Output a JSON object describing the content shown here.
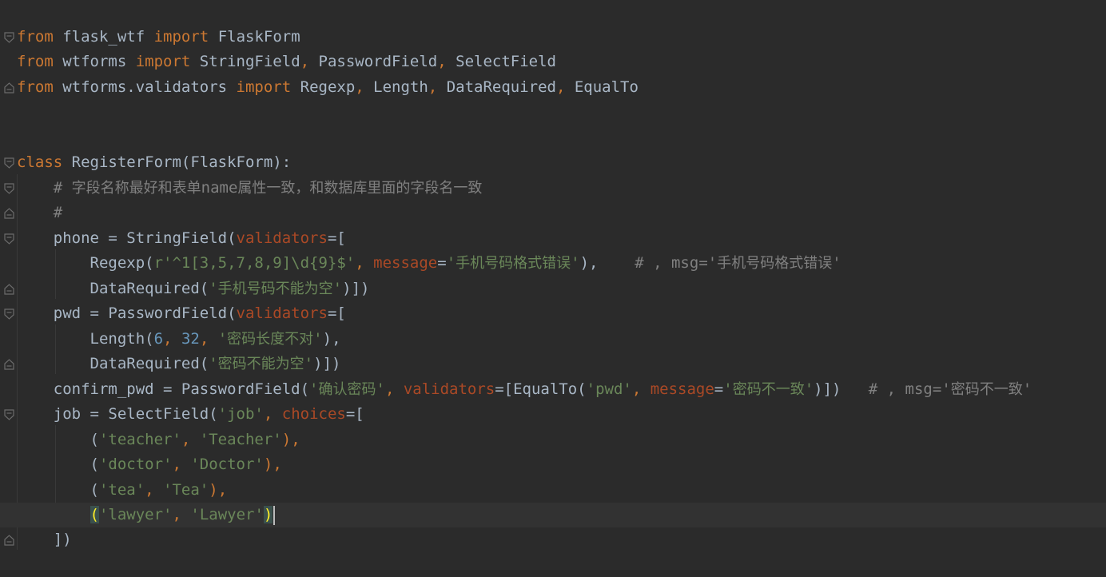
{
  "editor": {
    "language": "python",
    "theme_colors": {
      "background": "#2b2b2b",
      "current_line": "#323232",
      "keyword": "#cc7832",
      "string": "#6a8759",
      "number": "#6897bb",
      "comment": "#808080",
      "parameter": "#aa4926",
      "default_text": "#a9b7c6"
    },
    "fold_icons": [
      "fold-open-icon",
      "fold-close-icon"
    ],
    "lines": [
      "from flask_wtf import FlaskForm",
      "from wtforms import StringField, PasswordField, SelectField",
      "from wtforms.validators import Regexp, Length, DataRequired, EqualTo",
      "",
      "",
      "class RegisterForm(FlaskForm):",
      "    # 字段名称最好和表单name属性一致，和数据库里面的字段名一致",
      "    #",
      "    phone = StringField(validators=[",
      "        Regexp(r'^1[3,5,7,8,9]\\d{9}$', message='手机号码格式错误'),    # , msg='手机号码格式错误'",
      "        DataRequired('手机号码不能为空')])",
      "    pwd = PasswordField(validators=[",
      "        Length(6, 32, '密码长度不对'),",
      "        DataRequired('密码不能为空')])",
      "    confirm_pwd = PasswordField('确认密码', validators=[EqualTo('pwd', message='密码不一致')])   # , msg='密码不一致'",
      "    job = SelectField('job', choices=[",
      "        ('teacher', 'Teacher'),",
      "        ('doctor', 'Doctor'),",
      "        ('tea', 'Tea'),",
      "        ('lawyer', 'Lawyer')",
      "    ])"
    ],
    "current_line": 20
  },
  "tokens": {
    "l1": [
      "from",
      " flask_wtf ",
      "import",
      " FlaskForm"
    ],
    "l2": [
      "from",
      " wtforms ",
      "import",
      " StringField",
      ",",
      " PasswordField",
      ",",
      " SelectField"
    ],
    "l3": [
      "from",
      " wtforms.validators ",
      "import",
      " Regexp",
      ",",
      " Length",
      ",",
      " DataRequired",
      ",",
      " EqualTo"
    ],
    "l6": [
      "class",
      " RegisterForm(FlaskForm):"
    ],
    "l7": [
      "    # ",
      "字段名称最好和表单",
      "name",
      "属性一致，和数据库里面的字段名一致"
    ],
    "l8": [
      "    #"
    ],
    "l9": [
      "    phone = StringField(",
      "validators",
      "=["
    ],
    "l10": [
      "        Regexp(",
      "r'^1[3,5,7,8,9]\\d{9}$'",
      ", ",
      "message",
      "=",
      "'",
      "手机号码格式错误",
      "'",
      "),",
      "    # , msg='",
      "手机号码格式错误",
      "'"
    ],
    "l11": [
      "        DataRequired(",
      "'",
      "手机号码不能为空",
      "'",
      ")])"
    ],
    "l12": [
      "    pwd = PasswordField(",
      "validators",
      "=["
    ],
    "l13": [
      "        Length(",
      "6",
      ", ",
      "32",
      ", ",
      "'",
      "密码长度不对",
      "'",
      "),"
    ],
    "l14": [
      "        DataRequired(",
      "'",
      "密码不能为空",
      "'",
      ")])"
    ],
    "l15": [
      "    confirm_pwd = PasswordField(",
      "'",
      "确认密码",
      "'",
      ", ",
      "validators",
      "=[EqualTo(",
      "'pwd'",
      ", ",
      "message",
      "=",
      "'",
      "密码不一致",
      "'",
      ")])",
      "   # , msg='",
      "密码不一致",
      "'"
    ],
    "l16": [
      "    job = SelectField(",
      "'job'",
      ", ",
      "choices",
      "=["
    ],
    "l17": [
      "        (",
      "'teacher'",
      ", ",
      "'Teacher'",
      "),"
    ],
    "l18": [
      "        (",
      "'doctor'",
      ", ",
      "'Doctor'",
      "),"
    ],
    "l19": [
      "        (",
      "'tea'",
      ", ",
      "'Tea'",
      "),"
    ],
    "l20": [
      "        ",
      "(",
      "'lawyer'",
      ", ",
      "'Lawyer'",
      ")"
    ],
    "l21": [
      "    ])"
    ]
  }
}
